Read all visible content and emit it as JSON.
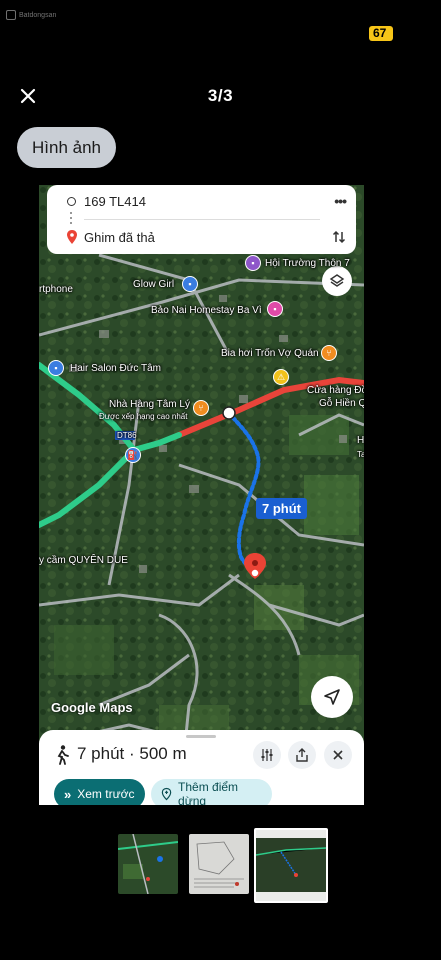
{
  "watermark": {
    "text": "Batdongsan"
  },
  "status_bar": {
    "badge": "67"
  },
  "viewer": {
    "counter": "3/3",
    "close_icon": "close-icon",
    "filter_chip": "Hình ảnh"
  },
  "map": {
    "route_card": {
      "origin": "169 TL414",
      "destination": "Ghim đã thả"
    },
    "eta_callout": "7 phút",
    "labels": {
      "hoi_truong": "Hội Trường Thôn 7",
      "glow_girl": "Glow Girl",
      "smartphone": "rtphone",
      "bao_nai": "Bảo Nai Homestay Ba Vì",
      "bia_hoi": "Bia hơi Trốn Vợ Quán",
      "hair_salon": "Hair Salon Đức Tâm",
      "cua_hang_1": "Cửa hàng Đồ",
      "cua_hang_2": "Gỗ Hiền Quyên",
      "nha_hang": "Nhà Hàng Tâm Lý",
      "nha_hang_sub": "Được xếp hạng cao nhất",
      "road_dt86": "DT86",
      "quyen_due": "y cầm QUYÊN DUE",
      "edge_h": "H",
      "edge_ta": "Ta"
    },
    "branding": "Google Maps",
    "bottom_sheet": {
      "summary": "7 phút · 500 m",
      "preview_button": "Xem trước",
      "add_stop_button": "Thêm điểm dừng"
    }
  },
  "thumbnails": [
    {
      "name": "thumbnail-map-1",
      "selected": false
    },
    {
      "name": "thumbnail-document",
      "selected": false
    },
    {
      "name": "thumbnail-map-2",
      "selected": true
    }
  ],
  "colors": {
    "background": "#000000",
    "chip": "#c9ced5",
    "route_green": "#2ecc8a",
    "route_red": "#e8443a",
    "walk_blue": "#1a73e8",
    "pin_red": "#ea4335",
    "badge_yellow": "#f7c518",
    "preview_teal": "#0b6e73"
  }
}
